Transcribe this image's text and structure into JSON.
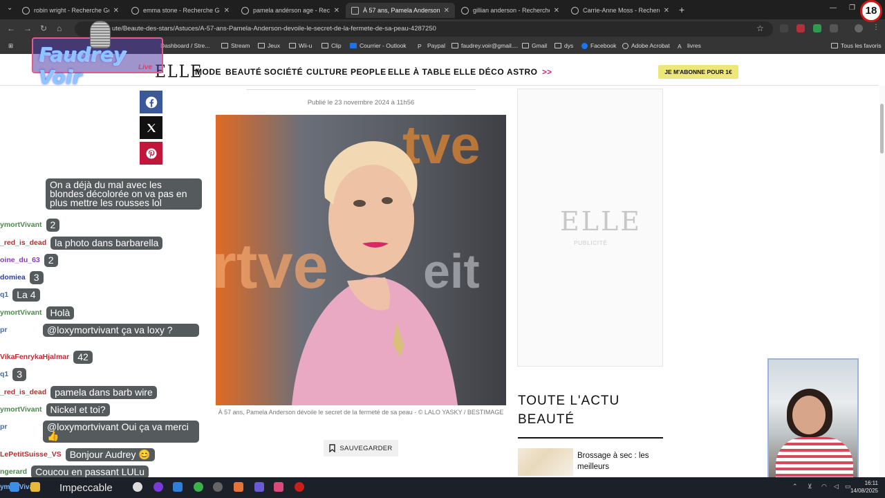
{
  "browser": {
    "tabs": [
      {
        "title": "robin wright - Recherche Google",
        "active": false
      },
      {
        "title": "emma stone - Recherche Google",
        "active": false
      },
      {
        "title": "pamela andérson age - Recherche",
        "active": false
      },
      {
        "title": "À 57 ans, Pamela Anderson dévoile",
        "active": true
      },
      {
        "title": "gillian anderson - Recherche Google",
        "active": false
      },
      {
        "title": "Carrie-Anne Moss - Recherche",
        "active": false
      }
    ],
    "new_tab": "+",
    "url": "ute/Beaute-des-stars/Astuces/A-57-ans-Pamela-Anderson-devoile-le-secret-de-la-fermete-de-sa-peau-4287250",
    "bookmarks": [
      "Dashboard / Stre...",
      "Stream",
      "Jeux",
      "Wii-u",
      "Clip",
      "Courrier - Outlook",
      "Paypal",
      "faudrey.voir@gmail....",
      "Gmail",
      "dys",
      "Facebook",
      "Adobe Acrobat",
      "livres"
    ],
    "all_bookmarks": "Tous les favoris"
  },
  "site": {
    "logo": "ELLE",
    "nav": [
      "MODE",
      "BEAUTÉ",
      "SOCIÉTÉ",
      "CULTURE",
      "PEOPLE",
      "ELLE À TABLE",
      "ELLE DÉCO",
      "ASTRO"
    ],
    "nav_more": ">>",
    "subscribe": "JE M'ABONNE POUR 1€"
  },
  "article": {
    "published": "Publié le 23 novembre 2024 à 11h56",
    "photo_signs": [
      "rtve",
      "eit",
      "tve"
    ],
    "caption": "À 57 ans, Pamela Anderson dévoile le secret de la fermeté de sa peau - © LALO YASKY / BESTIMAGE",
    "save": "SAUVEGARDER"
  },
  "sidebar": {
    "ad_logo": "ELLE",
    "ad_label": "PUBLICITÉ",
    "section_title": "TOUTE L'ACTU BEAUTÉ",
    "item": "Brossage à sec : les meilleurs"
  },
  "overlay": {
    "logo": "Faudrey Voir",
    "tag": "Live",
    "badge": "18"
  },
  "chat": [
    {
      "user": "",
      "color": "#6fa3ff",
      "text": "On a déjà du mal avec les blondes décolorée on va pas en plus mettre les rousses lol"
    },
    {
      "user": "ymortVivant",
      "color": "#4a8a4a",
      "text": "2"
    },
    {
      "user": "_red_is_dead",
      "color": "#c0282c",
      "text": "la photo dans barbarella"
    },
    {
      "user": "oine_du_63",
      "color": "#8a3ab8",
      "text": "2"
    },
    {
      "user": "domiea",
      "color": "#2c3fa8",
      "text": "3"
    },
    {
      "user": "q1",
      "color": "#3b6fb0",
      "text": "La 4"
    },
    {
      "user": "ymortVivant",
      "color": "#4a8a4a",
      "text": "Holà"
    },
    {
      "user": "pr",
      "color": "#3b6fb0",
      "text": "@loxymortvivant ça va loxy ?"
    },
    {
      "user": "VikaFenrykaHjalmar",
      "color": "#c0282c",
      "text": "42"
    },
    {
      "user": "q1",
      "color": "#3b6fb0",
      "text": "3"
    },
    {
      "user": "_red_is_dead",
      "color": "#c0282c",
      "text": "pamela dans barb wire"
    },
    {
      "user": "ymortVivant",
      "color": "#4a8a4a",
      "text": "Nickel et toi?"
    },
    {
      "user": "pr",
      "color": "#3b6fb0",
      "text": "@loxymortvivant Oui ça va merci 👍"
    },
    {
      "user": "LePetitSuisse_VS",
      "color": "#c0282c",
      "text": "Bonjour Audrey 😊"
    },
    {
      "user": "ngerard",
      "color": "#4a8a4a",
      "text": "Coucou en passant LULu"
    },
    {
      "user": "ymortVivant",
      "color": "#4a8a4a",
      "text": "Impeccable"
    }
  ],
  "taskbar": {
    "time": "16:11",
    "date": "14/08/2025"
  }
}
